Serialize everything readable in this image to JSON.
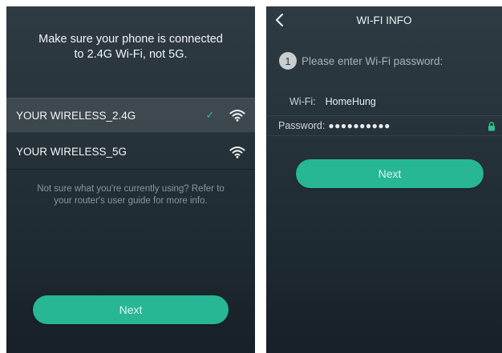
{
  "left_screen": {
    "instruction": "Make sure your phone is connected to 2.4G Wi-Fi, not 5G.",
    "networks": [
      {
        "name": "YOUR WIRELESS_2.4G",
        "selected": true,
        "icon": "wifi-icon"
      },
      {
        "name": "YOUR WIRELESS_5G",
        "selected": false,
        "icon": "wifi-icon"
      }
    ],
    "check_icon": "✓",
    "help_text": "Not sure what you're currently using? Refer to your router's user guide for more info.",
    "next_label": "Next"
  },
  "right_screen": {
    "title": "WI-FI INFO",
    "step_number": "1",
    "step_text": "Please enter Wi-Fi password:",
    "wifi_label": "Wi-Fi:",
    "wifi_value": "HomeHung",
    "password_label": "Password:",
    "password_value": "●●●●●●●●●●",
    "next_label": "Next"
  },
  "colors": {
    "accent": "#27b795",
    "background": "#27333a",
    "check": "#27c096",
    "lock": "#2fc28f"
  }
}
